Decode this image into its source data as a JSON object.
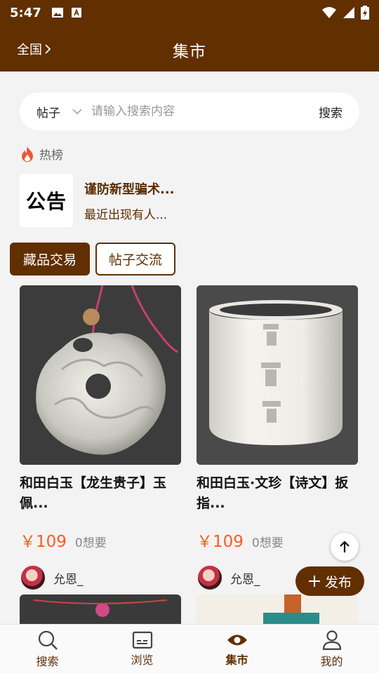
{
  "status_bar": {
    "time": "5:47"
  },
  "header": {
    "region": "全国",
    "title": "集市"
  },
  "search": {
    "type": "帖子",
    "placeholder": "请输入搜索内容",
    "button": "搜索"
  },
  "hot": {
    "label": "热榜"
  },
  "notice": {
    "thumb_text": "公告",
    "title": "谨防新型骗术...",
    "desc": "最近出现有人..."
  },
  "tabs": [
    {
      "label": "藏品交易",
      "active": true
    },
    {
      "label": "帖子交流",
      "active": false
    }
  ],
  "items": [
    {
      "title": "和田白玉【龙生贵子】玉佩...",
      "price": "￥109",
      "wants": "0想要",
      "author": "允恩_"
    },
    {
      "title": "和田白玉·文珍【诗文】扳指...",
      "price": "￥109",
      "wants": "0想要",
      "author": "允恩_"
    }
  ],
  "publish": {
    "label": "发布"
  },
  "bottom_nav": [
    {
      "label": "搜索",
      "icon": "search-icon"
    },
    {
      "label": "浏览",
      "icon": "browse-icon"
    },
    {
      "label": "集市",
      "icon": "market-icon",
      "active": true
    },
    {
      "label": "我的",
      "icon": "profile-icon"
    }
  ],
  "colors": {
    "brand": "#612f00",
    "price": "#ff5a1f"
  }
}
